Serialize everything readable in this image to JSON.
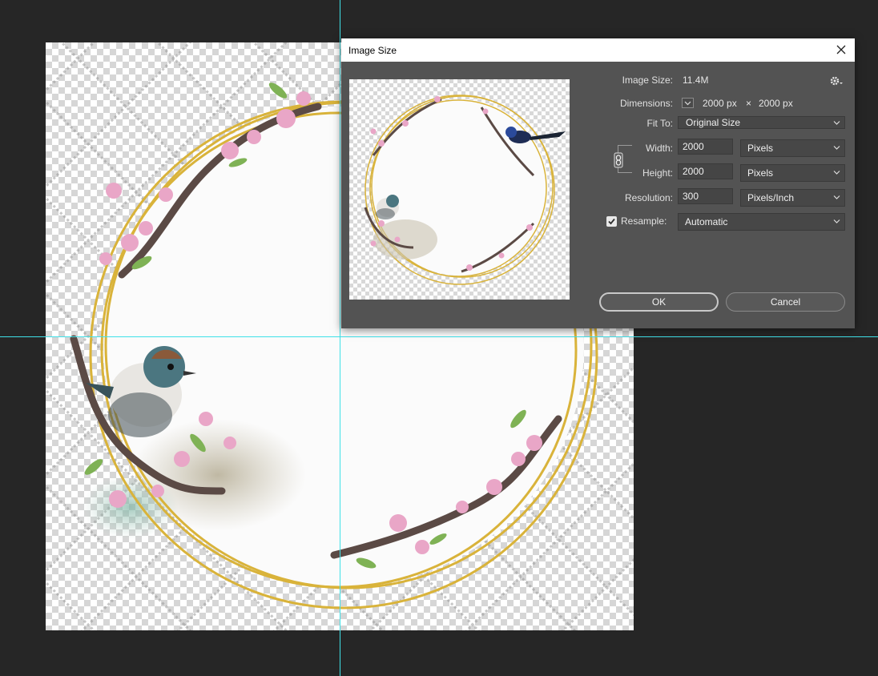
{
  "dialog": {
    "title": "Image Size",
    "image_size_label": "Image Size:",
    "image_size_value": "11.4M",
    "dimensions_label": "Dimensions:",
    "dim_width": "2000 px",
    "dim_times": "×",
    "dim_height": "2000 px",
    "fit_to_label": "Fit To:",
    "fit_to_value": "Original Size",
    "width_label": "Width:",
    "width_value": "2000",
    "width_unit": "Pixels",
    "height_label": "Height:",
    "height_value": "2000",
    "height_unit": "Pixels",
    "resolution_label": "Resolution:",
    "resolution_value": "300",
    "resolution_unit": "Pixels/Inch",
    "resample_label": "Resample:",
    "resample_checked": true,
    "resample_value": "Automatic",
    "ok_label": "OK",
    "cancel_label": "Cancel"
  },
  "icons": [
    "close-icon",
    "gear-icon",
    "chevron-down-icon",
    "link-icon",
    "checkmark-icon"
  ],
  "colors": {
    "workspace_bg": "#262626",
    "dialog_bg": "#535353",
    "guide": "#3fe1e8",
    "ring_gold": "#d9b33a"
  }
}
